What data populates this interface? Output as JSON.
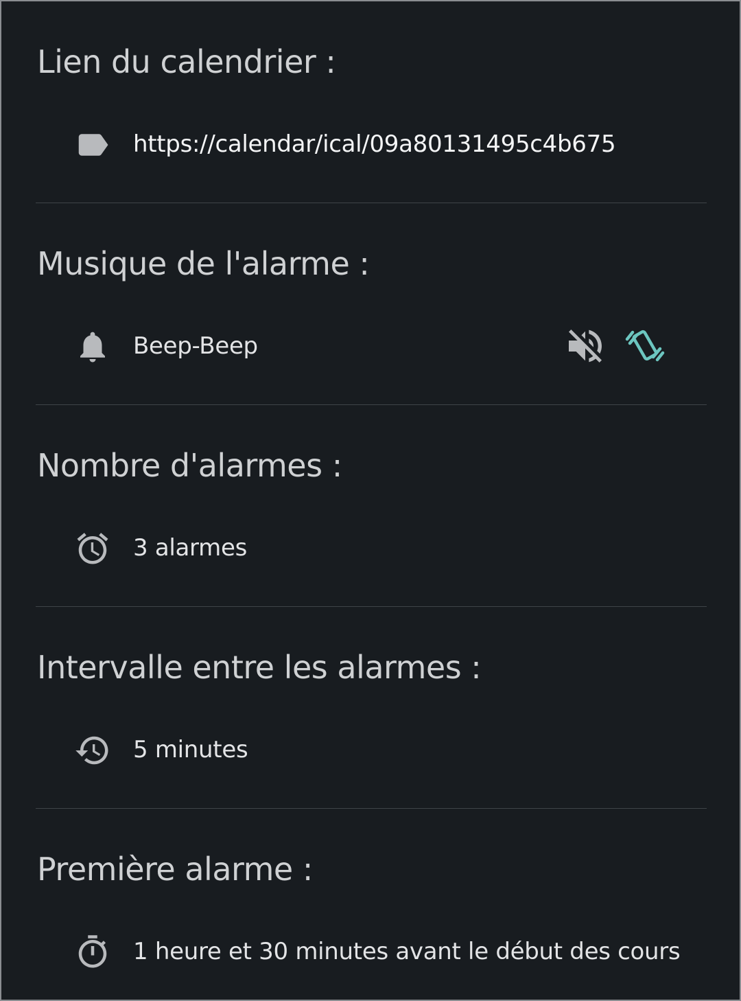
{
  "colors": {
    "background": "#181c20",
    "title_text": "#cfd1d3",
    "value_text": "#e3e4e6",
    "icon_gray": "#b8babd",
    "accent_teal": "#6cc6c0",
    "divider": "#3f4448"
  },
  "sections": [
    {
      "title": "Lien du calendrier :",
      "icon": "label-icon",
      "value": "https://calendar/ical/09a80131495c4b675"
    },
    {
      "title": "Musique de l'alarme :",
      "icon": "bell-icon",
      "value": "Beep-Beep",
      "toggles": [
        {
          "icon": "volume-off-icon",
          "color": "#b8babd"
        },
        {
          "icon": "vibrate-icon",
          "color": "#6cc6c0"
        }
      ]
    },
    {
      "title": "Nombre d'alarmes :",
      "icon": "alarm-clock-icon",
      "value": "3 alarmes"
    },
    {
      "title": "Intervalle entre les alarmes :",
      "icon": "history-icon",
      "value": "5 minutes"
    },
    {
      "title": "Première alarme :",
      "icon": "timer-icon",
      "value": "1 heure et 30 minutes avant le début des cours"
    }
  ]
}
